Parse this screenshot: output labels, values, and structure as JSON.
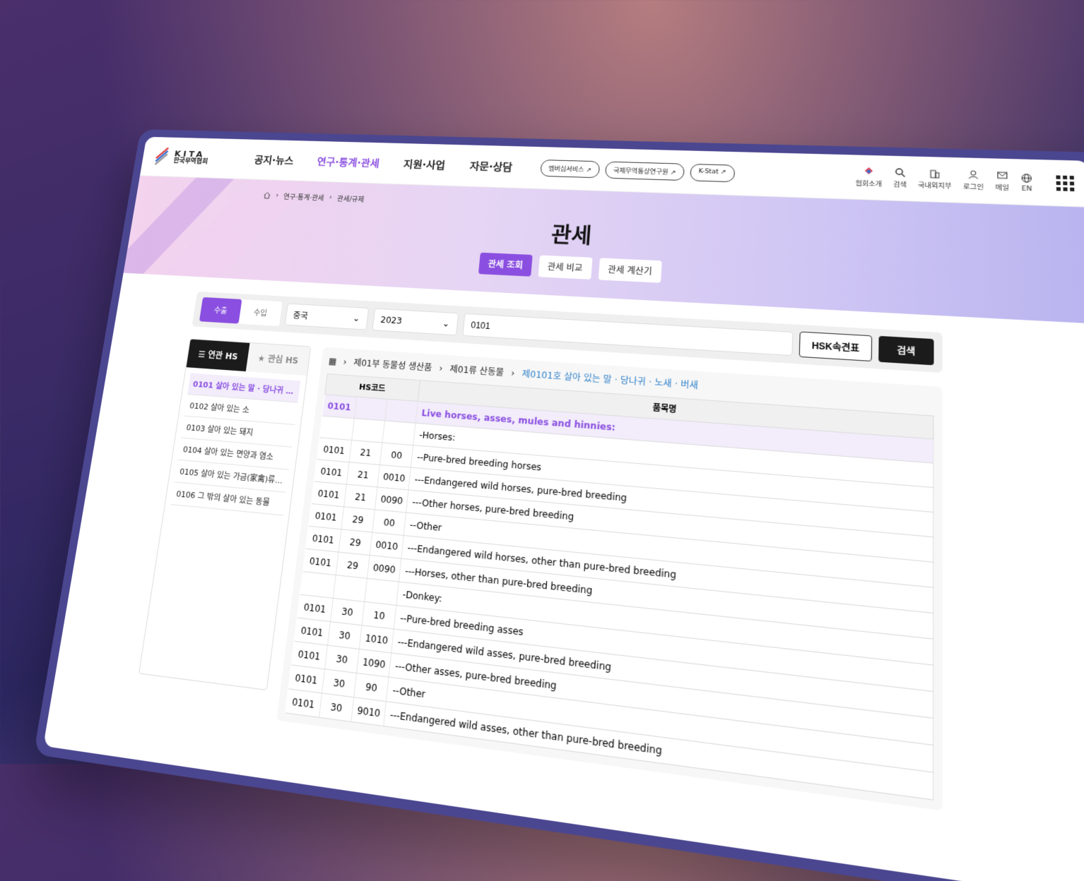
{
  "header": {
    "logo_en": "KITA",
    "logo_ko": "한국무역협회",
    "nav": [
      "공지·뉴스",
      "연구·통계·관세",
      "지원·사업",
      "자문·상담"
    ],
    "nav_active_index": 1,
    "external_links": [
      "멤버십서비스 ↗",
      "국제무역통상연구원 ↗",
      "K-Stat ↗"
    ],
    "utils": [
      {
        "label": "협회소개",
        "icon": "kita-icon"
      },
      {
        "label": "검색",
        "icon": "search-icon"
      },
      {
        "label": "국내외지부",
        "icon": "building-icon"
      },
      {
        "label": "로그인",
        "icon": "user-icon"
      },
      {
        "label": "메일",
        "icon": "mail-icon"
      },
      {
        "label": "EN",
        "icon": "globe-icon"
      }
    ]
  },
  "hero": {
    "breadcrumb": [
      "연구·통계·관세",
      "관세/규제"
    ],
    "title": "관세",
    "tabs": [
      "관세 조회",
      "관세 비교",
      "관세 계산기"
    ]
  },
  "search": {
    "segments": [
      "수출",
      "수입"
    ],
    "country": "중국",
    "year": "2023",
    "query": "0101",
    "hsk_button": "HSK속견표",
    "search_button": "검색"
  },
  "sidebar": {
    "tabs": [
      "☰ 연관 HS",
      "★ 관심 HS"
    ],
    "items": [
      "0101  살아 있는 말 · 당나귀 · ...",
      "0102  살아 있는 소",
      "0103  살아 있는 돼지",
      "0104  살아 있는 면양과 염소",
      "0105  살아 있는 가금(家禽)류[...",
      "0106  그 밖의 살아 있는 동물"
    ]
  },
  "main": {
    "crumbs": [
      "제01부 동물성 생산품",
      "제01류 산동물",
      "제0101호 살아 있는 말 · 당나귀 · 노새 · 버새"
    ],
    "columns": [
      "HS코드",
      "품목명"
    ],
    "rows": [
      [
        "0101",
        "",
        "",
        "Live horses, asses, mules and hinnies:"
      ],
      [
        "",
        "",
        "",
        "-Horses:"
      ],
      [
        "0101",
        "21",
        "00",
        "--Pure-bred breeding horses"
      ],
      [
        "0101",
        "21",
        "0010",
        "---Endangered wild horses, pure-bred breeding"
      ],
      [
        "0101",
        "21",
        "0090",
        "---Other horses, pure-bred breeding"
      ],
      [
        "0101",
        "29",
        "00",
        "--Other"
      ],
      [
        "0101",
        "29",
        "0010",
        "---Endangered wild horses, other than pure-bred breeding"
      ],
      [
        "0101",
        "29",
        "0090",
        "---Horses, other than pure-bred breeding"
      ],
      [
        "",
        "",
        "",
        "-Donkey:"
      ],
      [
        "0101",
        "30",
        "10",
        "--Pure-bred breeding asses"
      ],
      [
        "0101",
        "30",
        "1010",
        "---Endangered wild asses, pure-bred breeding"
      ],
      [
        "0101",
        "30",
        "1090",
        "---Other asses, pure-bred breeding"
      ],
      [
        "0101",
        "30",
        "90",
        "--Other"
      ],
      [
        "0101",
        "30",
        "9010",
        "---Endangered wild asses, other than pure-bred breeding"
      ]
    ]
  },
  "colors": {
    "accent": "#8a4fe0",
    "link": "#2c7fc9",
    "frame": "#4b4690"
  }
}
